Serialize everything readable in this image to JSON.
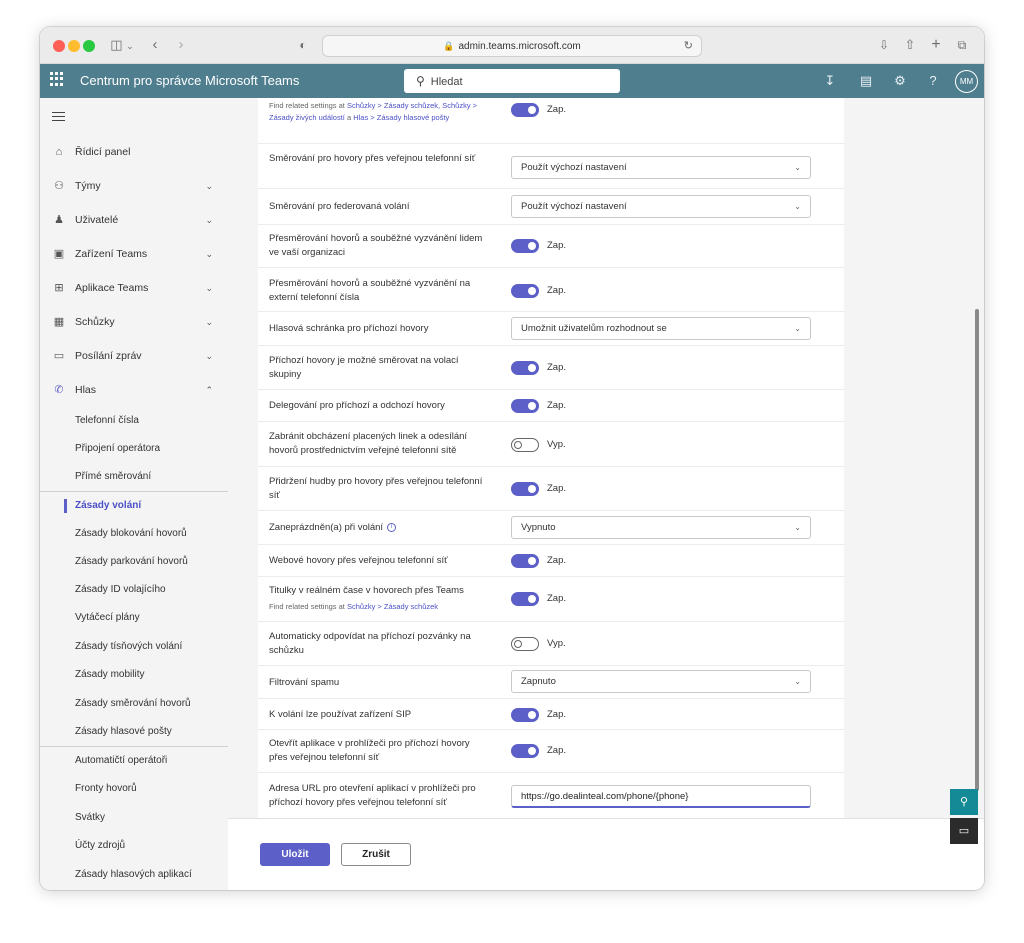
{
  "browser": {
    "url": "admin.teams.microsoft.com"
  },
  "app": {
    "title": "Centrum pro správce Microsoft Teams",
    "search_placeholder": "Hledat",
    "avatar_initials": "MM"
  },
  "sidebar": {
    "items": [
      {
        "label": "Řídicí panel",
        "icon": "dashboard-icon"
      },
      {
        "label": "Týmy",
        "icon": "teams-icon"
      },
      {
        "label": "Uživatelé",
        "icon": "users-icon"
      },
      {
        "label": "Zařízení Teams",
        "icon": "devices-icon"
      },
      {
        "label": "Aplikace Teams",
        "icon": "apps-icon"
      },
      {
        "label": "Schůzky",
        "icon": "meetings-icon"
      },
      {
        "label": "Posílání zpráv",
        "icon": "messaging-icon"
      },
      {
        "label": "Hlas",
        "icon": "voice-icon"
      }
    ],
    "voice_subitems": [
      "Telefonní čísla",
      "Připojení operátora",
      "Přímé směrování",
      "Zásady volání",
      "Zásady blokování hovorů",
      "Zásady parkování hovorů",
      "Zásady ID volajícího",
      "Vytáčecí plány",
      "Zásady tísňových volání",
      "Zásady mobility",
      "Zásady směrování hovorů",
      "Zásady hlasové pošty",
      "Automatičtí operátoři",
      "Fronty hovorů",
      "Svátky",
      "Účty zdrojů",
      "Zásady hlasových aplikací"
    ],
    "active_item": "Zásady volání"
  },
  "settings": {
    "top_note": {
      "prefix": "Find related settings at ",
      "links": [
        "Schůzky > Zásady schůzek,",
        "Schůzky > Zásady živých událostí",
        "Hlas > Zásady hlasové pošty"
      ],
      "and": " a "
    },
    "top_toggle": {
      "state": "Zap."
    },
    "rows": [
      {
        "label": "Směrování pro hovory přes veřejnou telefonní síť",
        "control": "dropdown",
        "value": "Použít výchozí nastavení"
      },
      {
        "label": "Směrování pro federovaná volání",
        "control": "dropdown",
        "value": "Použít výchozí nastavení"
      },
      {
        "label": "Přesměrování hovorů a souběžné vyzvánění lidem ve vaší organizaci",
        "control": "toggle",
        "on": true,
        "value": "Zap."
      },
      {
        "label": "Přesměrování hovorů a souběžné vyzvánění na externí telefonní čísla",
        "control": "toggle",
        "on": true,
        "value": "Zap."
      },
      {
        "label": "Hlasová schránka pro příchozí hovory",
        "control": "dropdown",
        "value": "Umožnit uživatelům rozhodnout se"
      },
      {
        "label": "Příchozí hovory je možné směrovat na volací skupiny",
        "control": "toggle",
        "on": true,
        "value": "Zap."
      },
      {
        "label": "Delegování pro příchozí a odchozí hovory",
        "control": "toggle",
        "on": true,
        "value": "Zap."
      },
      {
        "label": "Zabránit obcházení placených linek a odesílání hovorů prostřednictvím veřejné telefonní sítě",
        "control": "toggle",
        "on": false,
        "value": "Vyp."
      },
      {
        "label": "Přidržení hudby pro hovory přes veřejnou telefonní síť",
        "control": "toggle",
        "on": true,
        "value": "Zap."
      },
      {
        "label": "Zaneprázdněn(a) při volání",
        "control": "dropdown",
        "value": "Vypnuto",
        "info": true
      },
      {
        "label": "Webové hovory přes veřejnou telefonní síť",
        "control": "toggle",
        "on": true,
        "value": "Zap."
      },
      {
        "label": "Titulky v reálném čase v hovorech přes Teams",
        "control": "toggle",
        "on": true,
        "value": "Zap.",
        "note_prefix": "Find related settings at ",
        "note_link": "Schůzky > Zásady schůzek"
      },
      {
        "label": "Automaticky odpovídat na příchozí pozvánky na schůzku",
        "control": "toggle",
        "on": false,
        "value": "Vyp."
      },
      {
        "label": "Filtrování spamu",
        "control": "dropdown",
        "value": "Zapnuto"
      },
      {
        "label": "K volání lze používat zařízení SIP",
        "control": "toggle",
        "on": true,
        "value": "Zap."
      },
      {
        "label": "Otevřít aplikace v prohlížeči pro příchozí hovory přes veřejnou telefonní síť",
        "control": "toggle",
        "on": true,
        "value": "Zap."
      },
      {
        "label": "Adresa URL pro otevření aplikací v prohlížeči pro příchozí hovory přes veřejnou telefonní síť",
        "control": "text",
        "value": "https://go.dealinteal.com/phone/{phone}"
      }
    ]
  },
  "footer": {
    "save_label": "Uložit",
    "cancel_label": "Zrušit"
  },
  "colors": {
    "accent": "#5b5fc7",
    "header": "#4f7e8f",
    "help_button": "#138a96"
  }
}
